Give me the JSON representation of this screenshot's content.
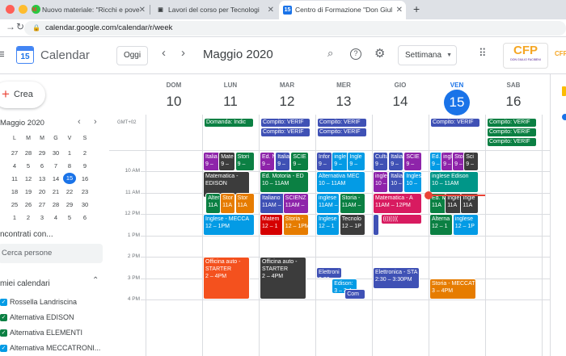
{
  "browser": {
    "tabs": [
      {
        "title": "Nuovo materiale: \"Ricchi e pove",
        "favicon": "M",
        "color": "#ea4335"
      },
      {
        "title": "Lavori del corso per Tecnologi",
        "favicon": "▣",
        "color": "#3c4043"
      },
      {
        "title": "Centro di Formazione \"Don Giul",
        "favicon": "15",
        "color": "#1a73e8"
      }
    ],
    "new_tab": "+",
    "url": "calendar.google.com/calendar/r/week"
  },
  "header": {
    "app_name": "Calendar",
    "logo_day": "15",
    "today_label": "Oggi",
    "period": "Maggio 2020",
    "view_label": "Settimana",
    "org_logo": "CFP",
    "org_sub": "DON GIULIO FACIBENI",
    "org_logo2": "CFP"
  },
  "sidebar": {
    "create_label": "Crea",
    "mini_month": "Maggio 2020",
    "weekday_letters": [
      "L",
      "M",
      "M",
      "G",
      "V",
      "S"
    ],
    "weeks": [
      [
        "27",
        "28",
        "29",
        "30",
        "1",
        "2"
      ],
      [
        "4",
        "5",
        "6",
        "7",
        "8",
        "9"
      ],
      [
        "11",
        "12",
        "13",
        "14",
        "15",
        "16"
      ],
      [
        "18",
        "19",
        "20",
        "21",
        "22",
        "23"
      ],
      [
        "25",
        "26",
        "27",
        "28",
        "29",
        "30"
      ],
      [
        "1",
        "2",
        "3",
        "4",
        "5",
        "6"
      ]
    ],
    "today": "15",
    "search_title": "ncontrati con...",
    "search_placeholder": "Cerca persone",
    "my_cals_title": "miei calendari",
    "calendars": [
      {
        "name": "Rossella Landriscina",
        "color": "#039be5"
      },
      {
        "name": "Alternativa EDISON",
        "color": "#0b8043"
      },
      {
        "name": "Alternativa ELEMENTI",
        "color": "#0b8043"
      },
      {
        "name": "Alternativa MECCATRONI...",
        "color": "#039be5"
      }
    ]
  },
  "week": {
    "timezone": "GMT+02",
    "days": [
      {
        "dow": "DOM",
        "num": "10"
      },
      {
        "dow": "LUN",
        "num": "11"
      },
      {
        "dow": "MAR",
        "num": "12"
      },
      {
        "dow": "MER",
        "num": "13"
      },
      {
        "dow": "GIO",
        "num": "14"
      },
      {
        "dow": "VEN",
        "num": "15"
      },
      {
        "dow": "SAB",
        "num": "16"
      }
    ],
    "today_index": 5,
    "hours": [
      "10 AM",
      "11 AM",
      "12 PM",
      "1 PM",
      "2 PM",
      "3 PM",
      "4 PM"
    ],
    "allday": [
      {
        "day": 1,
        "row": 0,
        "text": "Domanda: Indic",
        "color": "#0b8043"
      },
      {
        "day": 2,
        "row": 0,
        "text": "Compito: VERIF",
        "color": "#3f51b5"
      },
      {
        "day": 2,
        "row": 1,
        "text": "Compito: VERIF",
        "color": "#3f51b5"
      },
      {
        "day": 3,
        "row": 0,
        "text": "Compito: VERIF",
        "color": "#3f51b5"
      },
      {
        "day": 3,
        "row": 1,
        "text": "Compito: VERIF",
        "color": "#3f51b5"
      },
      {
        "day": 5,
        "row": 0,
        "text": "Compito: VERIF",
        "color": "#3f51b5"
      },
      {
        "day": 6,
        "row": 0,
        "text": "Compito: VERIF",
        "color": "#0b8043"
      },
      {
        "day": 6,
        "row": 1,
        "text": "Compito: VERIF",
        "color": "#0b8043"
      },
      {
        "day": 6,
        "row": 2,
        "text": "Compito: VERIF",
        "color": "#0b8043"
      }
    ],
    "events": [
      {
        "day": 1,
        "start": 9,
        "end": 10,
        "l": 0,
        "w": 0.33,
        "l1": "Italia",
        "l2": "9 –",
        "color": "#8e24aa"
      },
      {
        "day": 1,
        "start": 9,
        "end": 10,
        "l": 0.3,
        "w": 0.33,
        "l1": "Mate",
        "l2": "9 –",
        "color": "#3c3c3c"
      },
      {
        "day": 1,
        "start": 9,
        "end": 10,
        "l": 0.62,
        "w": 0.38,
        "l1": "Stori",
        "l2": "9 –",
        "color": "#0b8043"
      },
      {
        "day": 1,
        "start": 10,
        "end": 11.25,
        "l": 0,
        "w": 0.9,
        "l1": "Matematica -",
        "l2": "EDISON",
        "color": "#3c3c3c"
      },
      {
        "day": 1,
        "start": 11,
        "end": 12,
        "l": 0.05,
        "w": 0.3,
        "l1": "Alter",
        "l2": "11A",
        "color": "#0b8043"
      },
      {
        "day": 1,
        "start": 11,
        "end": 12,
        "l": 0.33,
        "w": 0.3,
        "l1": "Stor",
        "l2": "11A",
        "color": "#e67c00"
      },
      {
        "day": 1,
        "start": 11,
        "end": 12,
        "l": 0.62,
        "w": 0.38,
        "l1": "Stor",
        "l2": "11A",
        "color": "#e67c00"
      },
      {
        "day": 1,
        "start": 12,
        "end": 13,
        "l": 0,
        "w": 1,
        "l1": "Inglese - MECCA",
        "l2": "12 – 1PM",
        "color": "#039be5"
      },
      {
        "day": 1,
        "start": 14,
        "end": 16,
        "l": 0,
        "w": 0.9,
        "l1": "Officina auto -",
        "l2": "STARTER",
        "l3": "2 – 4PM",
        "color": "#f4511e"
      },
      {
        "day": 2,
        "start": 9,
        "end": 10,
        "l": 0,
        "w": 0.3,
        "l1": "Ed. N",
        "l2": "9 –",
        "color": "#8e24aa"
      },
      {
        "day": 2,
        "start": 9,
        "end": 10,
        "l": 0.3,
        "w": 0.3,
        "l1": "Italia",
        "l2": "9 –",
        "color": "#3f51b5"
      },
      {
        "day": 2,
        "start": 9,
        "end": 10,
        "l": 0.6,
        "w": 0.35,
        "l1": "SCIE",
        "l2": "9 –",
        "color": "#0b8043"
      },
      {
        "day": 2,
        "start": 10,
        "end": 11,
        "l": 0,
        "w": 0.95,
        "l1": "Ed. Motoria - ED",
        "l2": "10 – 11AM",
        "color": "#0b8043"
      },
      {
        "day": 2,
        "start": 11,
        "end": 12,
        "l": 0,
        "w": 0.48,
        "l1": "Italiano",
        "l2": "11AM –",
        "color": "#3f51b5"
      },
      {
        "day": 2,
        "start": 11,
        "end": 12,
        "l": 0.45,
        "w": 0.5,
        "l1": "SCIENZ",
        "l2": "11AM –",
        "color": "#8e24aa"
      },
      {
        "day": 2,
        "start": 12,
        "end": 13,
        "l": 0,
        "w": 0.45,
        "l1": "Matem",
        "l2": "12 – 1",
        "color": "#d50000"
      },
      {
        "day": 2,
        "start": 12,
        "end": 13,
        "l": 0.45,
        "w": 0.5,
        "l1": "Storia -",
        "l2": "12 – 1PM",
        "color": "#e67c00"
      },
      {
        "day": 2,
        "start": 14,
        "end": 16,
        "l": 0,
        "w": 0.9,
        "l1": "Officina auto -",
        "l2": "STARTER",
        "l3": "2 – 4PM",
        "color": "#3c3c3c"
      },
      {
        "day": 3,
        "start": 9,
        "end": 10,
        "l": 0,
        "w": 0.32,
        "l1": "Infor",
        "l2": "9 –",
        "color": "#3f51b5"
      },
      {
        "day": 3,
        "start": 9,
        "end": 10,
        "l": 0.3,
        "w": 0.32,
        "l1": "ingle",
        "l2": "9 –",
        "color": "#039be5"
      },
      {
        "day": 3,
        "start": 9,
        "end": 10,
        "l": 0.6,
        "w": 0.35,
        "l1": "Ingle",
        "l2": "9 –",
        "color": "#039be5"
      },
      {
        "day": 3,
        "start": 10,
        "end": 11,
        "l": 0,
        "w": 0.95,
        "l1": "Alternativa MEC",
        "l2": "10 – 11AM",
        "color": "#039be5"
      },
      {
        "day": 3,
        "start": 11,
        "end": 12,
        "l": 0,
        "w": 0.45,
        "l1": "inglese",
        "l2": "11AM –",
        "color": "#039be5"
      },
      {
        "day": 3,
        "start": 11,
        "end": 12,
        "l": 0.45,
        "w": 0.5,
        "l1": "Storia -",
        "l2": "11AM –",
        "color": "#0b8043"
      },
      {
        "day": 3,
        "start": 12,
        "end": 13,
        "l": 0,
        "w": 0.45,
        "l1": "Inglese",
        "l2": "12 – 1",
        "color": "#039be5"
      },
      {
        "day": 3,
        "start": 12,
        "end": 13,
        "l": 0.45,
        "w": 0.5,
        "l1": "Tecnolo",
        "l2": "12 – 1P",
        "color": "#3c3c3c"
      },
      {
        "day": 3,
        "start": 14.5,
        "end": 15,
        "l": 0,
        "w": 0.5,
        "l1": "Elettroni",
        "l2": "2:30 –",
        "color": "#3f51b5"
      },
      {
        "day": 3,
        "start": 15,
        "end": 15.75,
        "l": 0.3,
        "w": 0.5,
        "l1": "Edison:",
        "l2": "3 – 3:4",
        "color": "#039be5"
      },
      {
        "day": 3,
        "start": 15.5,
        "end": 16,
        "l": 0.55,
        "w": 0.4,
        "l1": "Com",
        "l2": "",
        "color": "#3f51b5"
      },
      {
        "day": 4,
        "start": 9,
        "end": 10,
        "l": 0,
        "w": 0.3,
        "l1": "Cultu",
        "l2": "9 –",
        "color": "#3f51b5"
      },
      {
        "day": 4,
        "start": 9,
        "end": 10,
        "l": 0.3,
        "w": 0.3,
        "l1": "Italia",
        "l2": "9 –",
        "color": "#3f51b5"
      },
      {
        "day": 4,
        "start": 9,
        "end": 10,
        "l": 0.6,
        "w": 0.35,
        "l1": "SCIE",
        "l2": "9 –",
        "color": "#8e24aa"
      },
      {
        "day": 4,
        "start": 10,
        "end": 11,
        "l": 0,
        "w": 0.3,
        "l1": "inglese",
        "l2": "10 –",
        "color": "#8e24aa"
      },
      {
        "day": 4,
        "start": 10,
        "end": 11,
        "l": 0.3,
        "w": 0.3,
        "l1": "Italia",
        "l2": "10 –",
        "color": "#3f51b5"
      },
      {
        "day": 4,
        "start": 10,
        "end": 11,
        "l": 0.6,
        "w": 0.35,
        "l1": "Inglese",
        "l2": "10 –",
        "color": "#039be5"
      },
      {
        "day": 4,
        "start": 11,
        "end": 12,
        "l": 0,
        "w": 0.95,
        "l1": "Matematica - A",
        "l2": "11AM – 12PM",
        "color": "#d81b60"
      },
      {
        "day": 4,
        "start": 12,
        "end": 12.5,
        "l": 0.15,
        "w": 0.8,
        "l1": "((((((((",
        "l2": "",
        "color": "#d81b60"
      },
      {
        "day": 4,
        "start": 12,
        "end": 13,
        "l": 0,
        "w": 0.12,
        "l1": "",
        "l2": "",
        "color": "#3f51b5"
      },
      {
        "day": 4,
        "start": 14.5,
        "end": 15.5,
        "l": 0,
        "w": 0.9,
        "l1": "Elettronica - STA",
        "l2": "2:30 – 3:30PM",
        "color": "#3f51b5"
      },
      {
        "day": 5,
        "start": 9,
        "end": 10,
        "l": 0,
        "w": 0.25,
        "l1": "Ed.",
        "l2": "9 –",
        "color": "#039be5"
      },
      {
        "day": 5,
        "start": 9,
        "end": 10,
        "l": 0.22,
        "w": 0.25,
        "l1": "ingl",
        "l2": "9 –",
        "color": "#8e24aa"
      },
      {
        "day": 5,
        "start": 9,
        "end": 10,
        "l": 0.44,
        "w": 0.25,
        "l1": "Sto",
        "l2": "9 –",
        "color": "#8e24aa"
      },
      {
        "day": 5,
        "start": 9,
        "end": 10,
        "l": 0.66,
        "w": 0.3,
        "l1": "Sci",
        "l2": "9 –",
        "color": "#3c3c3c"
      },
      {
        "day": 5,
        "start": 10,
        "end": 11,
        "l": 0,
        "w": 0.95,
        "l1": "inglese Edison",
        "l2": "10 – 11AM",
        "color": "#009688"
      },
      {
        "day": 5,
        "start": 11,
        "end": 12,
        "l": 0,
        "w": 0.33,
        "l1": "Ed. M",
        "l2": "11A",
        "color": "#0b8043"
      },
      {
        "day": 5,
        "start": 11,
        "end": 12,
        "l": 0.3,
        "w": 0.33,
        "l1": "Ingle",
        "l2": "11A",
        "color": "#3c3c3c"
      },
      {
        "day": 5,
        "start": 11,
        "end": 12,
        "l": 0.6,
        "w": 0.35,
        "l1": "Ingle",
        "l2": "11A",
        "color": "#3c3c3c"
      },
      {
        "day": 5,
        "start": 12,
        "end": 13,
        "l": 0,
        "w": 0.45,
        "l1": "Alterna",
        "l2": "12 – 1",
        "color": "#0b8043"
      },
      {
        "day": 5,
        "start": 12,
        "end": 13,
        "l": 0.45,
        "w": 0.5,
        "l1": "inglese",
        "l2": "12 – 1P",
        "color": "#039be5"
      },
      {
        "day": 5,
        "start": 15,
        "end": 16,
        "l": 0,
        "w": 0.9,
        "l1": "Storia - MECCAT",
        "l2": "3 – 4PM",
        "color": "#e67c00"
      }
    ]
  }
}
